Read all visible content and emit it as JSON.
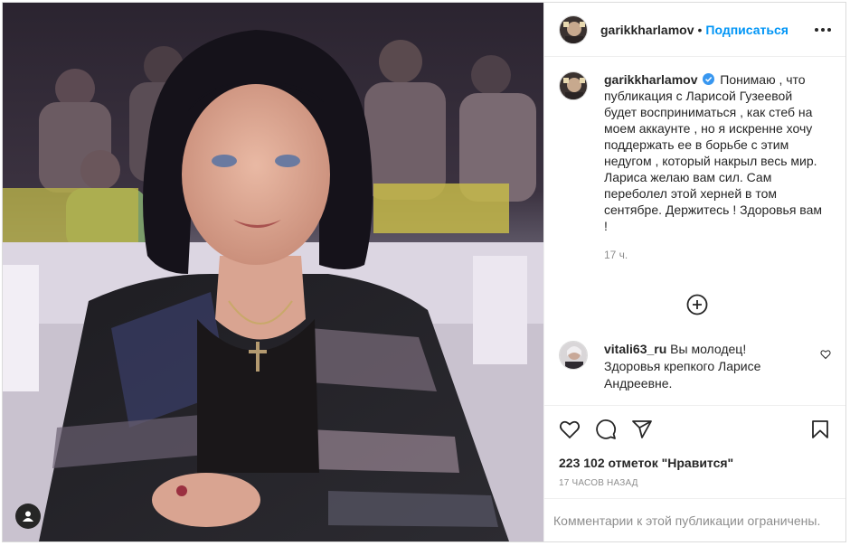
{
  "photo": {
    "alt_icon": "user-tag-icon"
  },
  "header": {
    "username": "garikkharlamov",
    "separator": "•",
    "follow_label": "Подписаться",
    "more_icon": "more-options-icon"
  },
  "caption": {
    "username": "garikkharlamov",
    "verified_icon": "verified-badge-icon",
    "text": "Понимаю , что публикация с Ларисой Гузеевой будет восприниматься , как стеб на моем аккаунте , но я искренне хочу поддержать ее в борьбе с этим недугом , который накрыл весь мир. Лариса желаю вам сил. Сам переболел этой херней в том сентябре. Держитесь ! Здоровья вам !",
    "time": "17 ч."
  },
  "load_more_icon": "plus-circle-icon",
  "comment": {
    "username": "vitali63_ru",
    "text": "Вы молодец! Здоровья крепкого Ларисе Андреевне."
  },
  "actions": {
    "like_icon": "heart-icon",
    "comment_icon": "comment-icon",
    "share_icon": "share-icon",
    "save_icon": "bookmark-icon"
  },
  "likes": "223 102 отметок \"Нравится\"",
  "posted_ago": "17 ЧАСОВ НАЗАД",
  "comments_limited": "Комментарии к этой публикации ограничены.",
  "colors": {
    "link": "#0095f6",
    "muted": "#8e8e8e",
    "text": "#262626",
    "border": "#efefef"
  }
}
